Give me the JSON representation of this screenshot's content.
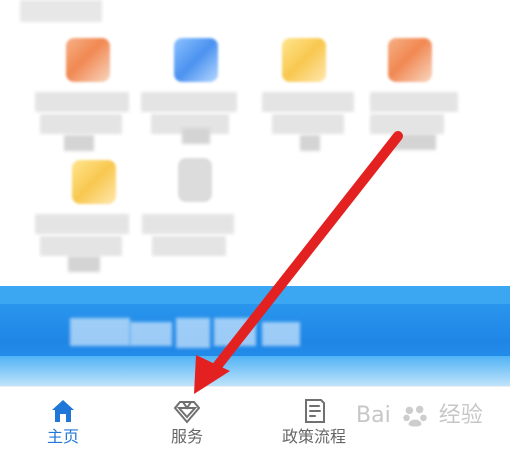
{
  "tabs": [
    {
      "label": "主页",
      "icon": "home-icon",
      "active": true
    },
    {
      "label": "服务",
      "icon": "diamond-icon",
      "active": false
    },
    {
      "label": "政策流程",
      "icon": "document-icon",
      "active": false
    }
  ],
  "watermark": {
    "left": "Bai",
    "right": "经验"
  },
  "colors": {
    "active": "#1f78d8",
    "inactive": "#666666",
    "banner": "#2f9df0",
    "arrow": "#e32121"
  }
}
